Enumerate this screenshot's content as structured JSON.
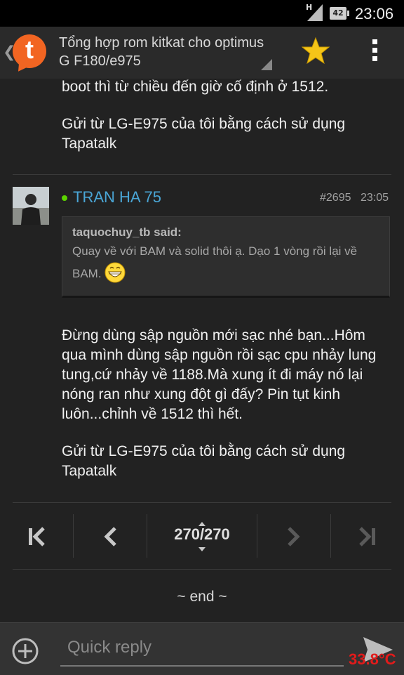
{
  "status_bar": {
    "network_type": "H",
    "battery_level": "42",
    "time": "23:06"
  },
  "header": {
    "logo_letter": "t",
    "thread_title": "Tổng hợp rom kitkat cho optimus G F180/e975",
    "star_icon": "star-icon",
    "overflow_icon": "overflow-menu-icon"
  },
  "previous_post": {
    "text_end": "boot thì từ chiều đến giờ cố định ở 1512.",
    "signature": "Gửi từ LG-E975 của tôi bằng cách sử dụng Tapatalk"
  },
  "post": {
    "username": "TRAN HA 75",
    "post_number": "#2695",
    "time": "23:05",
    "quote": {
      "author": "taquochuy_tb said:",
      "text": "Quay về với BAM và solid thôi ạ. Dạo 1 vòng rồi lại về BAM."
    },
    "body": "Đừng dùng sập nguồn mới sạc nhé bạn...Hôm qua mình dùng sập nguồn rồi sạc cpu nhảy lung tung,cứ nhảy về 1188.Mà xung ít đi máy nó lại nóng ran như xung đột gì đấy? Pin tụt kinh luôn...chỉnh về 1512 thì hết.",
    "signature": "Gửi từ LG-E975 của tôi bằng cách sử dụng Tapatalk"
  },
  "pager": {
    "current_page": "270/270"
  },
  "end_label": "~ end ~",
  "reply": {
    "placeholder": "Quick reply"
  },
  "overlay": {
    "temperature": "33.8°C"
  },
  "colors": {
    "accent_username": "#4aa6d6",
    "logo": "#f26522",
    "star": "#f5c518",
    "temperature": "#e21b1b",
    "online": "#5cd400"
  }
}
